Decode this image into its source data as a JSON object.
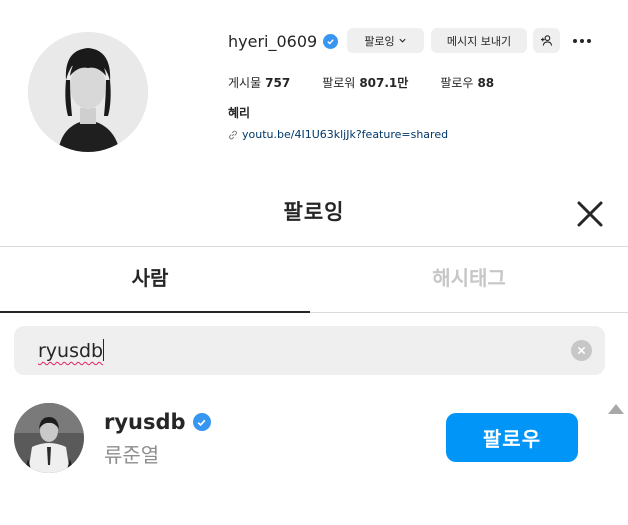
{
  "profile": {
    "username": "hyeri_0609",
    "following_label": "팔로잉",
    "message_label": "메시지 보내기",
    "stats": [
      {
        "label": "게시물",
        "value": "757"
      },
      {
        "label": "팔로워",
        "value": "807.1만"
      },
      {
        "label": "팔로우",
        "value": "88"
      }
    ],
    "full_name": "혜리",
    "link": "youtu.be/4I1U63kljJk?feature=shared"
  },
  "modal": {
    "title": "팔로잉",
    "tabs": [
      {
        "label": "사람",
        "active": true
      },
      {
        "label": "해시태그",
        "active": false
      }
    ],
    "search": {
      "value": "ryusdb"
    },
    "results": [
      {
        "username": "ryusdb",
        "verified": true,
        "full_name": "류준열",
        "follow_label": "팔로우"
      }
    ]
  },
  "colors": {
    "accent": "#0095f6",
    "verified": "#3797f0",
    "muted_text": "#8e8e8e",
    "link": "#00376b"
  },
  "icons": [
    "verified-badge-icon",
    "chevron-down-icon",
    "add-user-icon",
    "more-icon",
    "link-icon",
    "close-icon",
    "clear-search-icon",
    "scroll-up-icon"
  ]
}
